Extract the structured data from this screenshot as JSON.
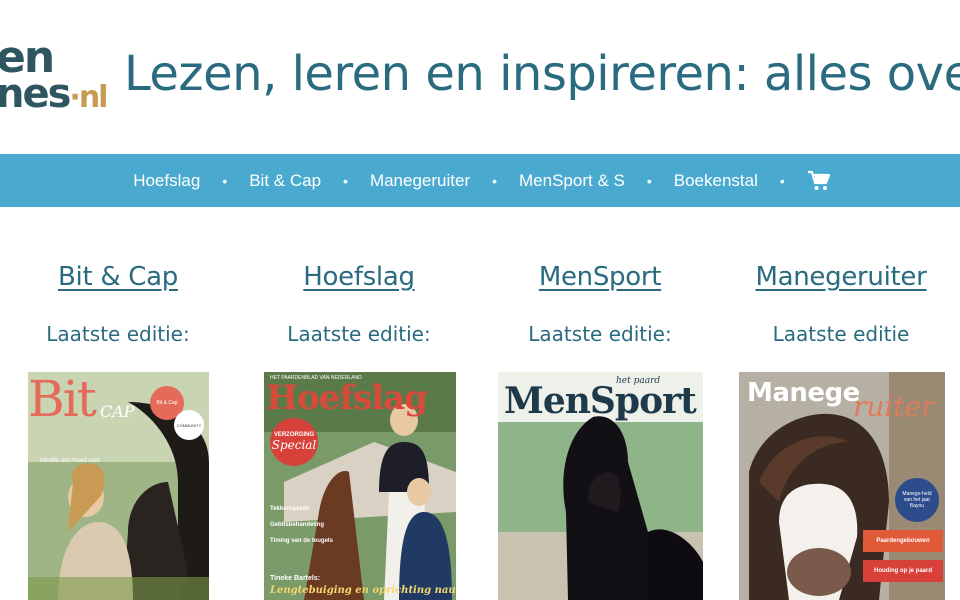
{
  "header": {
    "logo": {
      "line1": "en",
      "line2": "nes",
      "suffix": "·nl"
    },
    "tagline": "Lezen, leren en inspireren: alles over"
  },
  "nav": {
    "items": [
      "Hoefslag",
      "Bit & Cap",
      "Manegeruiter",
      "MenSport & S",
      "Boekenstal"
    ],
    "separator": "•",
    "cart_icon": "shopping-cart-icon"
  },
  "magazines": [
    {
      "title": "Bit & Cap",
      "edition_label": "Laatste editie:",
      "cover": {
        "masthead": "Bit",
        "masthead_sub": "CAP",
        "badge1": "Bit & Cap",
        "badge2": "COMMUNITY",
        "headline": "Mireille den Hoed over",
        "colors": {
          "bg": "#9fb585",
          "masthead": "#e46a5a",
          "badge": "#e46a5a"
        }
      }
    },
    {
      "title": "Hoefslag",
      "edition_label": "Laatste editie:",
      "cover": {
        "kicker": "HET PAARDENBLAD VAN NEDERLAND",
        "masthead": "Hoefslag",
        "badge_line1": "VERZORGING",
        "badge_line2": "Special",
        "lines": [
          "Tekkenrassen",
          "Gebitsbehandeling",
          "Timing van de teugels"
        ],
        "footer_name": "Tineke Bartels:",
        "footer_text": "Lengtebuiging en oprichting nauw",
        "colors": {
          "bg": "#7b9a6a",
          "masthead": "#d84a3a",
          "badge": "#d8403a"
        }
      }
    },
    {
      "title": "MenSport",
      "edition_label": "Laatste editie:",
      "cover": {
        "masthead": "MenSport",
        "kicker": "het paard",
        "colors": {
          "bg": "#8fb48a",
          "masthead": "#1e3a4a"
        }
      }
    },
    {
      "title": "Manegeruiter",
      "edition_label": "Laatste editie",
      "cover": {
        "masthead": "Manege",
        "masthead_script": "ruiter",
        "badge": "Manege-held van het jaar Bayou",
        "box1": "Paardengebouwen",
        "box2": "Houding op je paard",
        "colors": {
          "bg": "#b6b0a4",
          "masthead": "#ffffff",
          "script": "#e07a5a",
          "badge": "#2c4c8c",
          "box1": "#e05a3a",
          "box2": "#d8403a"
        }
      }
    }
  ]
}
